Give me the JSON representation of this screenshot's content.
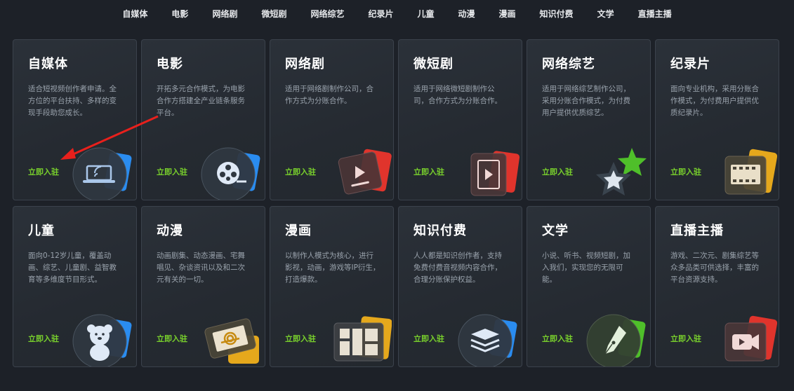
{
  "nav": {
    "items": [
      "自媒体",
      "电影",
      "网络剧",
      "微短剧",
      "网络综艺",
      "纪录片",
      "儿童",
      "动漫",
      "漫画",
      "知识付费",
      "文学",
      "直播主播"
    ]
  },
  "cards": [
    {
      "title": "自媒体",
      "desc": "适合短视频创作者申请。全方位的平台扶持、多样的变现手段助您成长。",
      "link": "立即入驻",
      "icon": "laptop-wifi-icon",
      "accent": "#2f7ee6"
    },
    {
      "title": "电影",
      "desc": "开拓多元合作模式，为电影合作方搭建全产业链条服务平台。",
      "link": "立即入驻",
      "icon": "film-reel-icon",
      "accent": "#2f7ee6"
    },
    {
      "title": "网络剧",
      "desc": "适用于网络剧制作公司，合作方式为分账合作。",
      "link": "立即入驻",
      "icon": "play-screen-icon",
      "accent": "#e0342c"
    },
    {
      "title": "微短剧",
      "desc": "适用于网络微短剧制作公司，合作方式为分账合作。",
      "link": "立即入驻",
      "icon": "film-play-icon",
      "accent": "#e0342c"
    },
    {
      "title": "网络综艺",
      "desc": "适用于网络综艺制作公司，采用分账合作模式，为付费用户提供优质综艺。",
      "link": "立即入驻",
      "icon": "stars-icon",
      "accent": "#4fbf2a"
    },
    {
      "title": "纪录片",
      "desc": "面向专业机构，采用分账合作模式，为付费用户提供优质纪录片。",
      "link": "立即入驻",
      "icon": "film-strip-icon",
      "accent": "#e5a81c"
    },
    {
      "title": "儿童",
      "desc": "面向0-12岁儿童，覆盖动画、综艺、儿童剧、益智教育等多维度节目形式。",
      "link": "立即入驻",
      "icon": "teddy-bear-icon",
      "accent": "#2f7ee6"
    },
    {
      "title": "动漫",
      "desc": "动画剧集、动态漫画、宅舞唱见、杂谈资讯以及和二次元有关的一切。",
      "link": "立即入驻",
      "icon": "ninja-ticket-icon",
      "accent": "#e5a81c"
    },
    {
      "title": "漫画",
      "desc": "以制作人模式为核心，进行影视，动画，游戏等IP衍生，打造爆款。",
      "link": "立即入驻",
      "icon": "comic-panels-icon",
      "accent": "#e5a81c"
    },
    {
      "title": "知识付费",
      "desc": "人人都是知识创作者，支持免费付费音视频内容合作，合理分账保护权益。",
      "link": "立即入驻",
      "icon": "books-icon",
      "accent": "#2f7ee6"
    },
    {
      "title": "文学",
      "desc": "小说、听书、视频短剧，加入我们，实现您的无限可能。",
      "link": "立即入驻",
      "icon": "pen-nib-icon",
      "accent": "#4fbf2a"
    },
    {
      "title": "直播主播",
      "desc": "游戏、二次元、剧集综艺等众多品类可供选择，丰富的平台资源支持。",
      "link": "立即入驻",
      "icon": "video-camera-icon",
      "accent": "#e0342c"
    }
  ]
}
